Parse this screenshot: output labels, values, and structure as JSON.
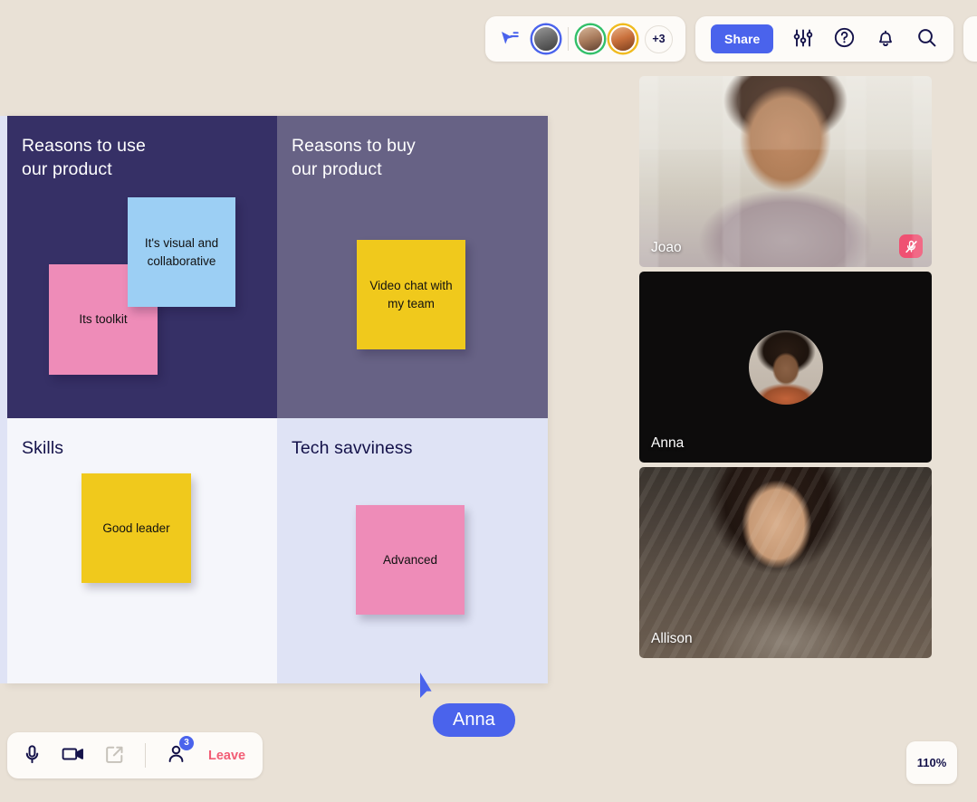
{
  "app": {
    "background_color": "#e9e1d6",
    "accent_color": "#4a63ec",
    "danger_color": "#f25d75"
  },
  "header": {
    "cursor_tool_icon": "cursor-pointer-icon",
    "collaborators": [
      {
        "name_ring_color": "#4a63ec",
        "icon": "avatar"
      },
      {
        "name_ring_color": "#33c06a",
        "icon": "avatar"
      },
      {
        "name_ring_color": "#f0bb1f",
        "icon": "avatar"
      }
    ],
    "overflow_label": "+3",
    "share_label": "Share",
    "settings_icon": "sliders-icon",
    "help_icon": "question-circle-icon",
    "notifications_icon": "bell-icon",
    "search_icon": "search-icon",
    "notes_icon": "document-icon"
  },
  "board": {
    "quadrants": [
      {
        "title": "Reasons to use\nour product",
        "title_line1": "Reasons to use",
        "title_line2": "our product",
        "bg": "#363066"
      },
      {
        "title_line1": "Reasons to buy",
        "title_line2": "our product",
        "bg": "#676285"
      },
      {
        "title_line1": "Skills",
        "title_line2": "",
        "bg": "#f5f6fb"
      },
      {
        "title_line1": "Tech savviness",
        "title_line2": "",
        "bg": "#dfe3f5"
      }
    ],
    "notes": [
      {
        "id": "toolkit",
        "text": "Its toolkit",
        "color": "#ee8cb8"
      },
      {
        "id": "visual",
        "text": "It's visual and collaborative",
        "color": "#9ccff4"
      },
      {
        "id": "videochat",
        "text": "Video chat with my team",
        "color": "#f0c91c"
      },
      {
        "id": "goodleader",
        "text": "Good leader",
        "color": "#f0c91c"
      },
      {
        "id": "advanced",
        "text": "Advanced",
        "color": "#ee8cb8"
      }
    ]
  },
  "remote_cursor": {
    "label": "Anna",
    "color": "#4a63ec"
  },
  "video_rail": [
    {
      "name": "Joao",
      "camera_on": true,
      "muted": true,
      "mute_icon": "microphone-off-icon"
    },
    {
      "name": "Anna",
      "camera_on": false,
      "muted": false,
      "avatar_icon": "avatar"
    },
    {
      "name": "Allison",
      "camera_on": true,
      "muted": false
    }
  ],
  "bottom_toolbar": {
    "mic_icon": "microphone-icon",
    "camera_icon": "video-camera-icon",
    "share_screen_icon": "share-screen-icon",
    "people_icon": "people-icon",
    "people_count": "3",
    "leave_label": "Leave"
  },
  "zoom_control": {
    "level": "110%"
  }
}
